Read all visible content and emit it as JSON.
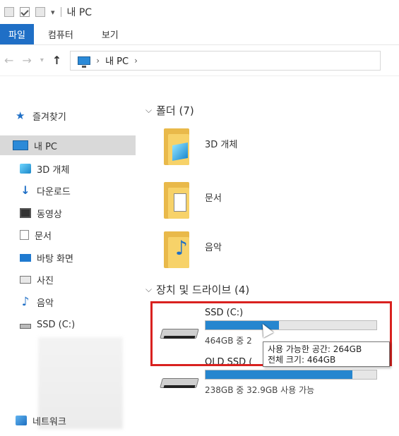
{
  "window": {
    "title": "내 PC"
  },
  "ribbon": {
    "tabs": [
      "파일",
      "컴퓨터",
      "보기"
    ]
  },
  "address": {
    "crumbs": [
      "내 PC"
    ]
  },
  "sidebar": {
    "items": [
      {
        "label": "즐겨찾기",
        "icon": "star-icon"
      },
      {
        "label": "내 PC",
        "icon": "computer-icon",
        "selected": true
      },
      {
        "label": "3D 개체",
        "icon": "3d-objects-icon"
      },
      {
        "label": "다운로드",
        "icon": "download-icon"
      },
      {
        "label": "동영상",
        "icon": "video-icon"
      },
      {
        "label": "문서",
        "icon": "document-icon"
      },
      {
        "label": "바탕 화면",
        "icon": "desktop-icon"
      },
      {
        "label": "사진",
        "icon": "picture-icon"
      },
      {
        "label": "음악",
        "icon": "music-icon"
      },
      {
        "label": "SSD (C:)",
        "icon": "drive-icon"
      },
      {
        "label": "네트워크",
        "icon": "network-icon"
      }
    ]
  },
  "folders": {
    "header": "폴더 (7)",
    "items": [
      {
        "label": "3D 개체",
        "icon": "3d-folder-icon"
      },
      {
        "label": "문서",
        "icon": "documents-folder-icon"
      },
      {
        "label": "음악",
        "icon": "music-folder-icon"
      }
    ]
  },
  "devices": {
    "header": "장치 및 드라이브 (4)",
    "drives": [
      {
        "name": "SSD (C:)",
        "free_text": "464GB 중 2",
        "used_fraction": 0.43
      },
      {
        "name": "OLD SSD (",
        "free_text": "238GB 중 32.9GB 사용 가능",
        "used_fraction": 0.86
      }
    ]
  },
  "tooltip": {
    "line1": "사용 가능한 공간: 264GB",
    "line2": "전체 크기: 464GB"
  },
  "colors": {
    "accent": "#1f6fc6",
    "bar_fill": "#2686cf",
    "highlight": "#d9211f"
  }
}
